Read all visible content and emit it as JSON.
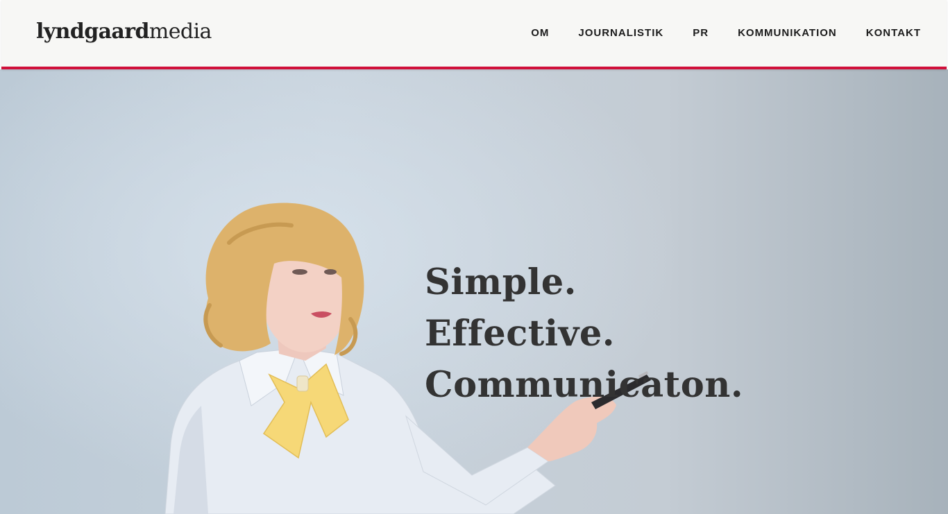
{
  "header": {
    "logo": {
      "bold_part": "lyndgaard",
      "light_part": "media"
    },
    "nav": [
      {
        "label": "OM"
      },
      {
        "label": "JOURNALISTIK"
      },
      {
        "label": "PR"
      },
      {
        "label": "KOMMUNIKATION"
      },
      {
        "label": "KONTAKT"
      }
    ],
    "accent_color": "#d0103a"
  },
  "hero": {
    "headline_lines": [
      "Simple.",
      "Effective.",
      "Communicaton."
    ],
    "image": "woman-with-yellow-bow-pointing-pen"
  }
}
